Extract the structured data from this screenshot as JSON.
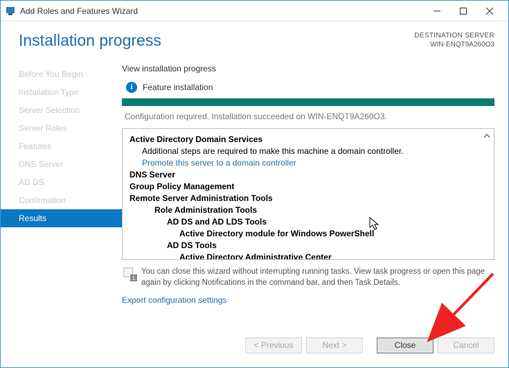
{
  "window": {
    "title": "Add Roles and Features Wizard"
  },
  "header": {
    "page_title": "Installation progress",
    "dest_label": "DESTINATION SERVER",
    "dest_value": "WIN-ENQT9A260O3"
  },
  "sidebar": {
    "items": [
      {
        "label": "Before You Begin"
      },
      {
        "label": "Installation Type"
      },
      {
        "label": "Server Selection"
      },
      {
        "label": "Server Roles"
      },
      {
        "label": "Features"
      },
      {
        "label": "DNS Server"
      },
      {
        "label": "AD DS"
      },
      {
        "label": "Confirmation"
      },
      {
        "label": "Results"
      }
    ]
  },
  "main": {
    "section_heading": "View installation progress",
    "feature_label": "Feature installation",
    "status_text": "Configuration required. Installation succeeded on WIN-ENQT9A260O3.",
    "note_text": "You can close this wizard without interrupting running tasks. View task progress or open this page again by clicking Notifications in the command bar, and then Task Details.",
    "export_link": "Export configuration settings",
    "results": {
      "adds_title": "Active Directory Domain Services",
      "adds_sub": "Additional steps are required to make this machine a domain controller.",
      "adds_link": "Promote this server to a domain controller",
      "dns": "DNS Server",
      "gpm": "Group Policy Management",
      "rsat": "Remote Server Administration Tools",
      "rat": "Role Administration Tools",
      "adlds": "AD DS and AD LDS Tools",
      "admod": "Active Directory module for Windows PowerShell",
      "addstools": "AD DS Tools",
      "adac": "Active Directory Administrative Center"
    }
  },
  "footer": {
    "prev": "< Previous",
    "next": "Next >",
    "close": "Close",
    "cancel": "Cancel"
  }
}
